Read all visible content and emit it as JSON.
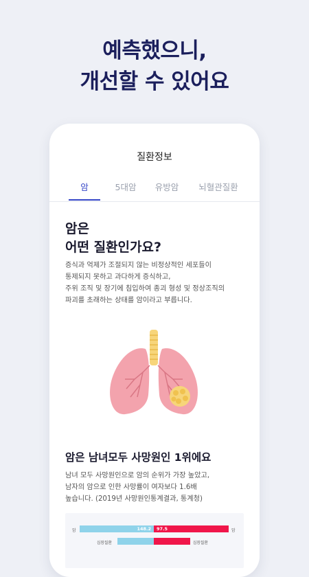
{
  "hero": {
    "line1": "예측했으니,",
    "line2": "개선할 수 있어요"
  },
  "screen": {
    "title": "질환정보",
    "tabs": [
      {
        "label": "암",
        "active": true
      },
      {
        "label": "5대암",
        "active": false
      },
      {
        "label": "유방암",
        "active": false
      },
      {
        "label": "뇌혈관질환",
        "active": false
      }
    ]
  },
  "section1": {
    "title_line1": "암은",
    "title_line2": "어떤 질환인가요?",
    "body_lines": [
      "증식과 억제가 조절되지 않는 비정상적인 세포들이",
      "통제되지 못하고 과다하게 증식하고,",
      "주위 조직 및 장기에 침입하여 종괴 형성 및 정상조직의",
      "파괴를 초래하는 상태를 암이라고 부릅니다."
    ]
  },
  "section2": {
    "title": "암은 남녀모두 사망원인 1위에요",
    "body_lines": [
      "남녀 모두 사망원인으로 암의 순위가 가장 높았고,",
      "남자의 암으로 인한 사망률이 여자보다 1.6배",
      "높습니다. (2019년 사망원인통계결과, 통계청)"
    ]
  },
  "chart_data": {
    "type": "bar",
    "rows": [
      {
        "label_left": "암",
        "left_value": 148.2,
        "right_value": 97.5,
        "label_right": "암"
      },
      {
        "label_left": "심장질환",
        "left_value": null,
        "right_value": null,
        "label_right": "심장질환"
      }
    ],
    "left_display": "148.2",
    "right_display": "97.5",
    "colors": {
      "left": "#8fd3ea",
      "right": "#f0164a"
    }
  },
  "colors": {
    "accent": "#3546c7",
    "hero_text": "#1b1f5c",
    "background": "#eef0f6"
  }
}
